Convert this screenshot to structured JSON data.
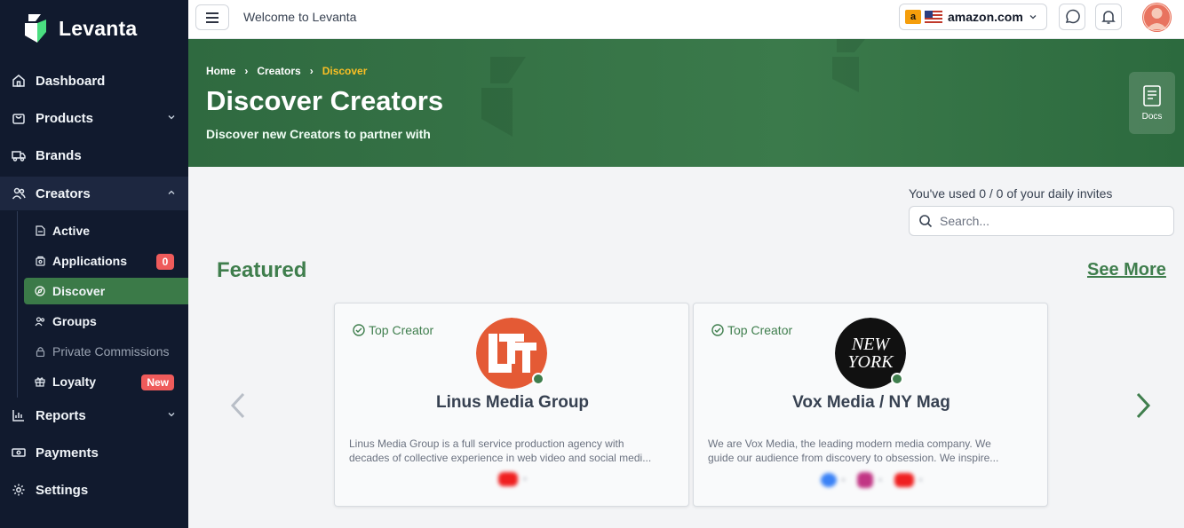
{
  "app": {
    "name": "Levanta"
  },
  "sidebar": {
    "items": [
      {
        "label": "Dashboard"
      },
      {
        "label": "Products"
      },
      {
        "label": "Brands"
      },
      {
        "label": "Creators"
      },
      {
        "label": "Reports"
      },
      {
        "label": "Payments"
      },
      {
        "label": "Settings"
      }
    ],
    "creators_sub": [
      {
        "label": "Active"
      },
      {
        "label": "Applications",
        "badge": "0"
      },
      {
        "label": "Discover"
      },
      {
        "label": "Groups"
      },
      {
        "label": "Private Commissions"
      },
      {
        "label": "Loyalty",
        "badge": "New"
      }
    ]
  },
  "topbar": {
    "welcome": "Welcome to Levanta",
    "marketplace": {
      "badge": "a",
      "label": "amazon.com"
    }
  },
  "hero": {
    "breadcrumb": [
      "Home",
      "Creators",
      "Discover"
    ],
    "title": "Discover Creators",
    "subtitle": "Discover new Creators to partner with",
    "docs_label": "Docs"
  },
  "main": {
    "invites_text": "You've used 0 / 0 of your daily invites",
    "search_placeholder": "Search...",
    "featured_title": "Featured",
    "see_more": "See More"
  },
  "cards": [
    {
      "tag": "Top Creator",
      "name": "Linus Media Group",
      "description_1": "Linus Media Group is a full service production agency with",
      "description_2": "decades of collective experience in web video and social medi..."
    },
    {
      "tag": "Top Creator",
      "name": "Vox Media / NY Mag",
      "logo_text_1": "NEW",
      "logo_text_2": "YORK",
      "description_1": "We are Vox Media, the leading modern media company. We",
      "description_2": "guide our audience from discovery to obsession. We inspire..."
    }
  ],
  "colors": {
    "sidebar_bg": "#111a2e",
    "accent_green": "#3f7e4d",
    "badge_red": "#ef5b5b",
    "breadcrumb_current": "#fbbf24"
  }
}
